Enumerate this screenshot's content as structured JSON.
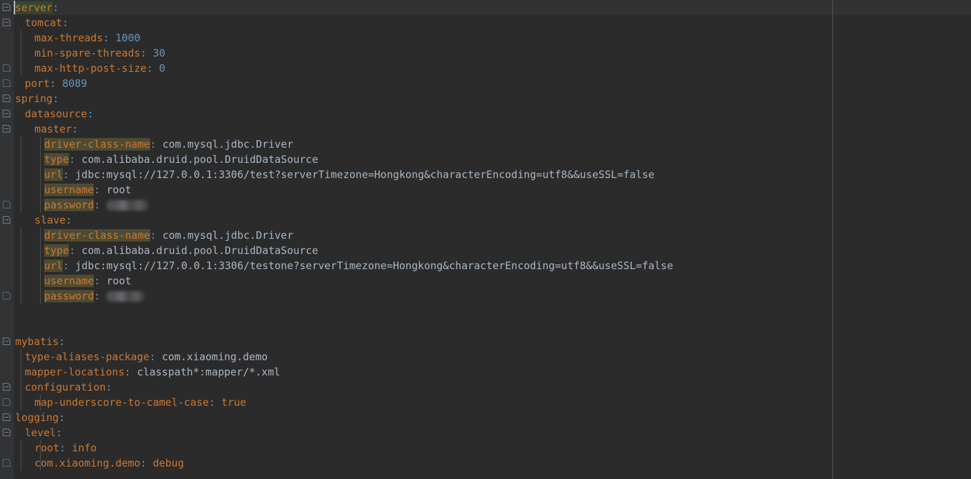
{
  "editor": {
    "theme": "darcula",
    "language": "yaml",
    "colors": {
      "background": "#2b2b2b",
      "gutter_background": "#313335",
      "current_line": "#323232",
      "key": "#cc7832",
      "value": "#a9b7c6",
      "number": "#6897bb",
      "punctuation": "#6897bb",
      "key_highlight": "#4e4b33",
      "selection": "#33472e",
      "indent_guide": "#4f5152",
      "margin_guide": "#555555",
      "caret": "#bbbbbb"
    }
  },
  "lines": [
    {
      "n": 1,
      "indent": 0,
      "key": "server",
      "key_state": "selected",
      "colon": ":",
      "value": "",
      "value_type": "none",
      "fold": "expanded",
      "current": true
    },
    {
      "n": 2,
      "indent": 1,
      "key": "tomcat",
      "key_state": "plain",
      "colon": ":",
      "value": "",
      "value_type": "none",
      "fold": "expanded",
      "current": false
    },
    {
      "n": 3,
      "indent": 2,
      "key": "max-threads",
      "key_state": "plain",
      "colon": ":",
      "value": "1000",
      "value_type": "number",
      "fold": "none",
      "current": false
    },
    {
      "n": 4,
      "indent": 2,
      "key": "min-spare-threads",
      "key_state": "plain",
      "colon": ":",
      "value": "30",
      "value_type": "number",
      "fold": "none",
      "current": false
    },
    {
      "n": 5,
      "indent": 2,
      "key": "max-http-post-size",
      "key_state": "plain",
      "colon": ":",
      "value": "0",
      "value_type": "number",
      "fold": "end",
      "current": false
    },
    {
      "n": 6,
      "indent": 1,
      "key": "port",
      "key_state": "plain",
      "colon": ":",
      "value": "8089",
      "value_type": "number",
      "fold": "end",
      "current": false
    },
    {
      "n": 7,
      "indent": 0,
      "key": "spring",
      "key_state": "plain",
      "colon": ":",
      "value": "",
      "value_type": "none",
      "fold": "expanded",
      "current": false
    },
    {
      "n": 8,
      "indent": 1,
      "key": "datasource",
      "key_state": "plain",
      "colon": ":",
      "value": "",
      "value_type": "none",
      "fold": "expanded",
      "current": false
    },
    {
      "n": 9,
      "indent": 2,
      "key": "master",
      "key_state": "plain",
      "colon": ":",
      "value": "",
      "value_type": "none",
      "fold": "expanded",
      "current": false
    },
    {
      "n": 10,
      "indent": 3,
      "key": "driver-class-name",
      "key_state": "highlight",
      "colon": ":",
      "value": "com.mysql.jdbc.Driver",
      "value_type": "plain",
      "fold": "none",
      "current": false
    },
    {
      "n": 11,
      "indent": 3,
      "key": "type",
      "key_state": "highlight",
      "colon": ":",
      "value": "com.alibaba.druid.pool.DruidDataSource",
      "value_type": "plain",
      "fold": "none",
      "current": false
    },
    {
      "n": 12,
      "indent": 3,
      "key": "url",
      "key_state": "highlight",
      "colon": ":",
      "value": "jdbc:mysql://127.0.0.1:3306/test?serverTimezone=Hongkong&characterEncoding=utf8&&useSSL=false",
      "value_type": "plain",
      "fold": "none",
      "current": false
    },
    {
      "n": 13,
      "indent": 3,
      "key": "username",
      "key_state": "highlight",
      "colon": ":",
      "value": "root",
      "value_type": "plain",
      "fold": "none",
      "current": false
    },
    {
      "n": 14,
      "indent": 3,
      "key": "password",
      "key_state": "highlight",
      "colon": ":",
      "value": "",
      "value_type": "redacted",
      "redact_width": 62,
      "fold": "end",
      "current": false
    },
    {
      "n": 15,
      "indent": 2,
      "key": "slave",
      "key_state": "plain",
      "colon": ":",
      "value": "",
      "value_type": "none",
      "fold": "expanded",
      "current": false
    },
    {
      "n": 16,
      "indent": 3,
      "key": "driver-class-name",
      "key_state": "highlight",
      "colon": ":",
      "value": "com.mysql.jdbc.Driver",
      "value_type": "plain",
      "fold": "none",
      "current": false
    },
    {
      "n": 17,
      "indent": 3,
      "key": "type",
      "key_state": "highlight",
      "colon": ":",
      "value": "com.alibaba.druid.pool.DruidDataSource",
      "value_type": "plain",
      "fold": "none",
      "current": false
    },
    {
      "n": 18,
      "indent": 3,
      "key": "url",
      "key_state": "highlight",
      "colon": ":",
      "value": "jdbc:mysql://127.0.0.1:3306/testone?serverTimezone=Hongkong&characterEncoding=utf8&&useSSL=false",
      "value_type": "plain",
      "fold": "none",
      "current": false
    },
    {
      "n": 19,
      "indent": 3,
      "key": "username",
      "key_state": "highlight",
      "colon": ":",
      "value": "root",
      "value_type": "plain",
      "fold": "none",
      "current": false
    },
    {
      "n": 20,
      "indent": 3,
      "key": "password",
      "key_state": "highlight",
      "colon": ":",
      "value": "",
      "value_type": "redacted",
      "redact_width": 56,
      "fold": "end",
      "current": false
    },
    {
      "n": 21,
      "indent": 0,
      "key": "",
      "key_state": "plain",
      "colon": "",
      "value": "",
      "value_type": "none",
      "fold": "none",
      "current": false
    },
    {
      "n": 22,
      "indent": 0,
      "key": "",
      "key_state": "plain",
      "colon": "",
      "value": "",
      "value_type": "none",
      "fold": "none",
      "current": false
    },
    {
      "n": 23,
      "indent": 0,
      "key": "mybatis",
      "key_state": "plain",
      "colon": ":",
      "value": "",
      "value_type": "none",
      "fold": "expanded",
      "current": false
    },
    {
      "n": 24,
      "indent": 1,
      "key": "type-aliases-package",
      "key_state": "plain",
      "colon": ":",
      "value": "com.xiaoming.demo",
      "value_type": "plain",
      "fold": "none",
      "current": false
    },
    {
      "n": 25,
      "indent": 1,
      "key": "mapper-locations",
      "key_state": "plain",
      "colon": ":",
      "value": "classpath*:mapper/*.xml",
      "value_type": "plain",
      "fold": "none",
      "current": false
    },
    {
      "n": 26,
      "indent": 1,
      "key": "configuration",
      "key_state": "plain",
      "colon": ":",
      "value": "",
      "value_type": "none",
      "fold": "expanded",
      "current": false
    },
    {
      "n": 27,
      "indent": 2,
      "key": "map-underscore-to-camel-case",
      "key_state": "plain",
      "colon": ":",
      "value": "true",
      "value_type": "bool",
      "fold": "end",
      "current": false
    },
    {
      "n": 28,
      "indent": 0,
      "key": "logging",
      "key_state": "plain",
      "colon": ":",
      "value": "",
      "value_type": "none",
      "fold": "expanded",
      "current": false
    },
    {
      "n": 29,
      "indent": 1,
      "key": "level",
      "key_state": "plain",
      "colon": ":",
      "value": "",
      "value_type": "none",
      "fold": "expanded",
      "current": false
    },
    {
      "n": 30,
      "indent": 2,
      "key": "root",
      "key_state": "plain",
      "colon": ":",
      "value": "info",
      "value_type": "bool",
      "fold": "none",
      "current": false
    },
    {
      "n": 31,
      "indent": 2,
      "key": "com.xiaoming.demo",
      "key_state": "plain",
      "colon": ":",
      "value": "debug",
      "value_type": "bool",
      "fold": "end",
      "current": false
    }
  ],
  "indent_guides": [
    {
      "x": 30,
      "from_line": 3,
      "to_line": 5
    },
    {
      "x": 30,
      "from_line": 10,
      "to_line": 14
    },
    {
      "x": 30,
      "from_line": 16,
      "to_line": 20
    },
    {
      "x": 30,
      "from_line": 24,
      "to_line": 27
    },
    {
      "x": 30,
      "from_line": 30,
      "to_line": 31
    },
    {
      "x": 58,
      "from_line": 10,
      "to_line": 14
    },
    {
      "x": 58,
      "from_line": 16,
      "to_line": 20
    },
    {
      "x": 58,
      "from_line": 27,
      "to_line": 27
    },
    {
      "x": 58,
      "from_line": 30,
      "to_line": 31
    }
  ],
  "caret": {
    "line": 1,
    "column": 0
  }
}
